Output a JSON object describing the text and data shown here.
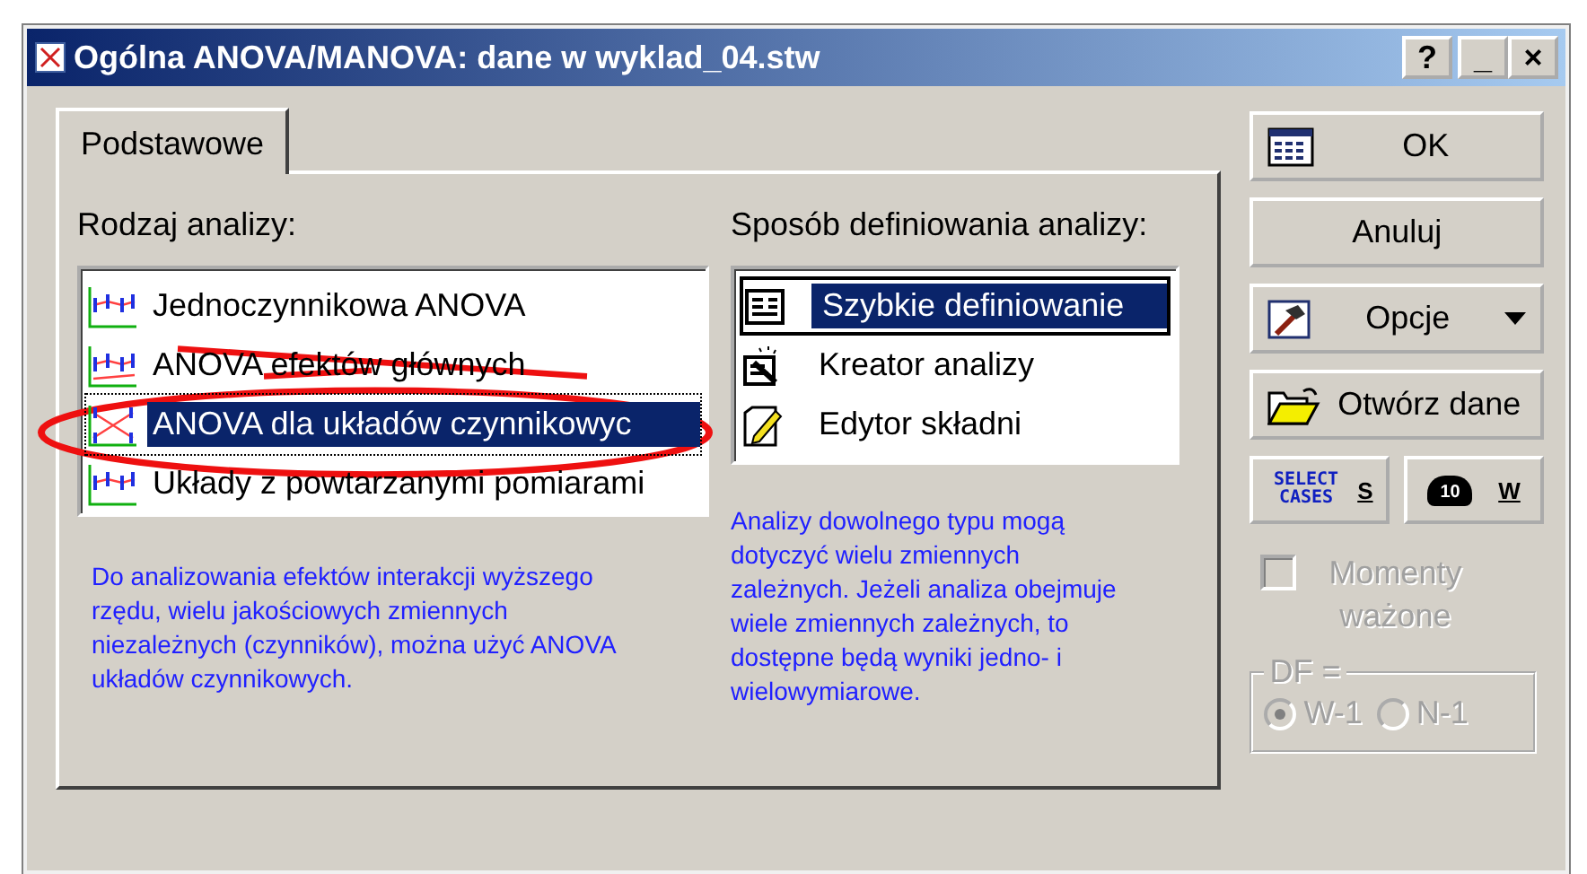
{
  "window": {
    "title": "Ogólna ANOVA/MANOVA: dane w wyklad_04.stw",
    "controls": [
      "?",
      "_",
      "×"
    ]
  },
  "tabs": [
    {
      "label": "Podstawowe",
      "selected": true
    }
  ],
  "analysis_type": {
    "label": "Rodzaj analizy:",
    "items": [
      {
        "label": "Jednoczynnikowa ANOVA",
        "selected": false
      },
      {
        "label": "ANOVA efektów głównych",
        "selected": false
      },
      {
        "label": "ANOVA dla układów czynnikowyc",
        "selected": true
      },
      {
        "label": "Układy z powtarzanymi pomiarami",
        "selected": false
      }
    ],
    "annotations": [
      {
        "kind": "strike"
      },
      {
        "kind": "ellipse"
      }
    ],
    "description": "Do analizowania efektów interakcji wyższego rzędu, wielu jakościowych zmiennych niezależnych (czynników), można użyć ANOVA układów czynnikowych."
  },
  "definition_method": {
    "label": "Sposób definiowania analizy:",
    "items": [
      {
        "label": "Szybkie definiowanie",
        "selected": true,
        "kind": "form"
      },
      {
        "label": "Kreator analizy",
        "selected": false,
        "kind": "wizard"
      },
      {
        "label": "Edytor składni",
        "selected": false,
        "kind": "editor"
      }
    ],
    "description": "Analizy dowolnego typu mogą dotyczyć wielu zmiennych zależnych. Jeżeli analiza obejmuje wiele zmiennych zależnych, to dostępne będą wyniki jedno- i wielowymiarowe."
  },
  "buttons": [
    {
      "label": "OK",
      "kind": "ok"
    },
    {
      "label": "Anuluj",
      "kind": "plain"
    },
    {
      "label": "Opcje",
      "kind": "menu"
    },
    {
      "label": "Otwórz dane",
      "kind": "open"
    }
  ],
  "small_buttons": [
    {
      "icon_text": "SELECT CASES",
      "key": "S"
    },
    {
      "icon_text": "10",
      "key": "W"
    }
  ],
  "weighted_moments": {
    "label": "Momenty ważone",
    "checked": false,
    "disabled": true
  },
  "df": {
    "label": "DF =",
    "disabled": true,
    "options": [
      {
        "label": "W-1",
        "selected": true
      },
      {
        "label": "N-1",
        "selected": false
      }
    ]
  }
}
